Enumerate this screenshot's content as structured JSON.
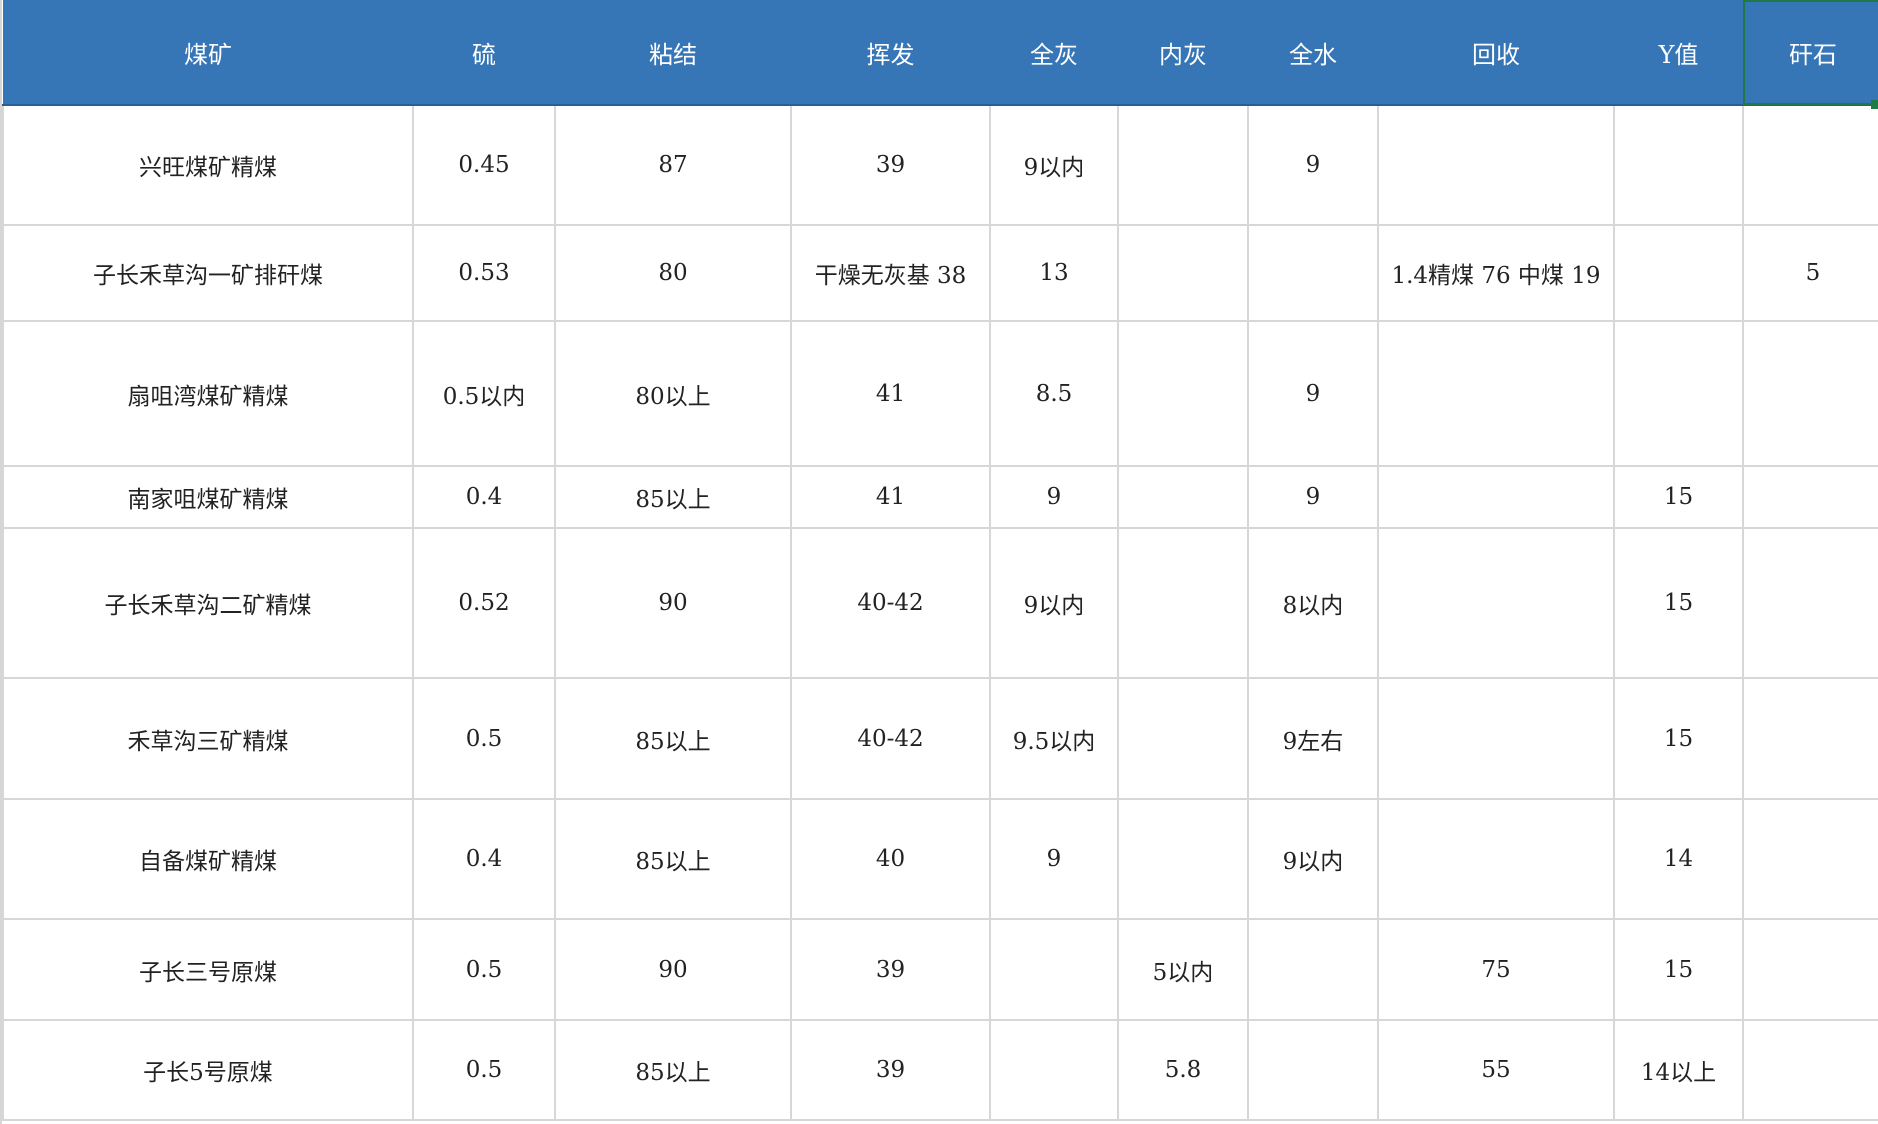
{
  "headers": [
    "煤矿",
    "硫",
    "粘结",
    "挥发",
    "全灰",
    "内灰",
    "全水",
    "回收",
    "Y值",
    "矸石"
  ],
  "rows": [
    [
      "兴旺煤矿精煤",
      "0.45",
      "87",
      "39",
      "9以内",
      "",
      "9",
      "",
      "",
      ""
    ],
    [
      "子长禾草沟一矿排矸煤",
      "0.53",
      "80",
      "干燥无灰基 38",
      "13",
      "",
      "",
      "1.4精煤 76 中煤 19",
      "",
      "5"
    ],
    [
      "扇咀湾煤矿精煤",
      "0.5以内",
      "80以上",
      "41",
      "8.5",
      "",
      "9",
      "",
      "",
      ""
    ],
    [
      "南家咀煤矿精煤",
      "0.4",
      "85以上",
      "41",
      "9",
      "",
      "9",
      "",
      "15",
      ""
    ],
    [
      "子长禾草沟二矿精煤",
      "0.52",
      "90",
      "40-42",
      "9以内",
      "",
      "8以内",
      "",
      "15",
      ""
    ],
    [
      "禾草沟三矿精煤",
      "0.5",
      "85以上",
      "40-42",
      "9.5以内",
      "",
      "9左右",
      "",
      "15",
      ""
    ],
    [
      "自备煤矿精煤",
      "0.4",
      "85以上",
      "40",
      "9",
      "",
      "9以内",
      "",
      "14",
      ""
    ],
    [
      "子长三号原煤",
      "0.5",
      "90",
      "39",
      "",
      "5以内",
      "",
      "75",
      "15",
      ""
    ],
    [
      "子长5号原煤",
      "0.5",
      "85以上",
      "39",
      "",
      "5.8",
      "",
      "55",
      "14以上",
      ""
    ]
  ],
  "colors": {
    "header_bg": "#3675b6",
    "header_text": "#ffffff",
    "grid": "#d7d7d7",
    "selection": "#1f7a46"
  }
}
